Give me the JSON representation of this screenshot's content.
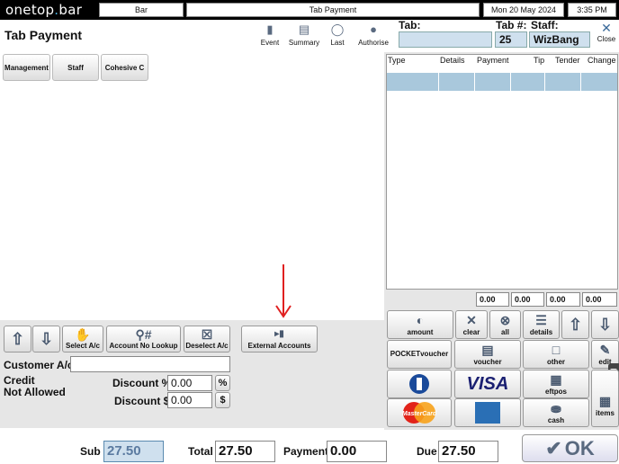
{
  "topbar": {
    "logo_a": "onetop",
    "logo_dot": ".",
    "logo_b": "bar",
    "venue": "Bar",
    "screen": "Tab Payment",
    "date": "Mon 20 May 2024",
    "time": "3:35 PM"
  },
  "header": {
    "title": "Tab Payment",
    "buttons": [
      {
        "label": "Event",
        "icon": "event-icon"
      },
      {
        "label": "Summary",
        "icon": "summary-icon"
      },
      {
        "label": "Last",
        "icon": "last-icon"
      },
      {
        "label": "Authorise",
        "icon": "authorise-icon"
      }
    ],
    "tab_label": "Tab:",
    "tab_value": "",
    "tabnum_label": "Tab #:",
    "tabnum_value": "25",
    "staff_label": "Staff:",
    "staff_value": "WizBang",
    "close_label": "Close"
  },
  "categories": [
    "Management",
    "Staff",
    "Cohesive C"
  ],
  "account_toolbar": {
    "select_label": "Select A/c",
    "lookup_label": "Account No Lookup",
    "deselect_label": "Deselect A/c",
    "external_label": "External Accounts"
  },
  "account_form": {
    "customer_label": "Customer A/c",
    "customer_value": "",
    "credit_line1": "Credit",
    "credit_line2": "Not Allowed",
    "discount_pct_label": "Discount %",
    "discount_pct_value": "0.00",
    "discount_pct_btn": "%",
    "discount_amt_label": "Discount $",
    "discount_amt_value": "0.00",
    "discount_amt_btn": "$"
  },
  "tender_table": {
    "columns": [
      "Type",
      "Details",
      "Payment",
      "Tip",
      "Tender",
      "Change"
    ],
    "totals": [
      "0.00",
      "0.00",
      "0.00",
      "0.00"
    ]
  },
  "payment_buttons": {
    "amount": "amount",
    "clear": "clear",
    "all": "all",
    "details": "details",
    "pocketvoucher": "POCKETvoucher",
    "voucher": "voucher",
    "other": "other",
    "edit": "edit",
    "visa": "VISA",
    "eftpos": "eftpos",
    "mastercard": "MasterCard",
    "cash": "cash",
    "items": "items"
  },
  "footer": {
    "sub_label": "Sub",
    "sub_value": "27.50",
    "total_label": "Total",
    "total_value": "27.50",
    "payment_label": "Payment",
    "payment_value": "0.00",
    "due_label": "Due",
    "due_value": "27.50",
    "ok_label": "OK"
  },
  "colors": {
    "accent_blue": "#a9c8dc",
    "annotation_red": "#e02020",
    "amex_blue": "#2a6fb5",
    "visa_blue": "#1a1f71"
  }
}
